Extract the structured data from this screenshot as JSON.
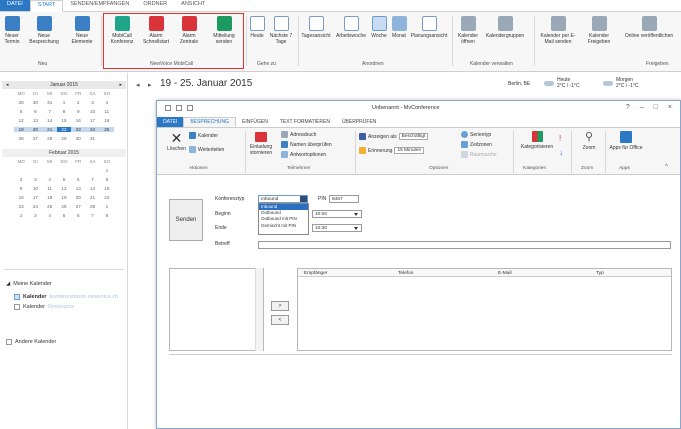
{
  "outlook": {
    "tabs": [
      {
        "label": "DATEI"
      },
      {
        "label": "START"
      },
      {
        "label": "SENDEN/EMPFANGEN"
      },
      {
        "label": "ORDNER"
      },
      {
        "label": "ANSICHT"
      }
    ],
    "ribbon": {
      "neu": {
        "items": [
          "Neuer Termin",
          "Neue Besprechung",
          "Neue Elemente"
        ],
        "label": "Neu"
      },
      "mobicall": {
        "items": [
          "MobiCall Konferenz",
          "Alarm Schnellstart",
          "Alarm Zentrale",
          "Mitteilung senden"
        ],
        "label": "NewVoice MobiCall"
      },
      "gehe_zu": {
        "items": [
          "Heute",
          "Nächste 7 Tage"
        ],
        "label": "Gehe zu"
      },
      "anordnen": {
        "items": [
          "Tagesansicht",
          "Arbeitswoche",
          "Woche",
          "Monat",
          "Planungsansicht"
        ],
        "label": "Anordnen"
      },
      "kalender_verwalten": {
        "items": [
          "Kalender öffnen",
          "Kalendergruppen"
        ],
        "label": "Kalender verwalten"
      },
      "freigeben": {
        "items": [
          "Kalender per E-Mail senden",
          "Kalender Freigeben",
          "Online veröffentlichen"
        ],
        "label": "Freigeben"
      }
    },
    "mini_calendars": [
      {
        "title": "Januar 2015",
        "dow": [
          "MO",
          "DI",
          "MI",
          "DO",
          "FR",
          "SA",
          "SO"
        ],
        "weeks": [
          [
            "29",
            "30",
            "31",
            "1",
            "2",
            "3",
            "4"
          ],
          [
            "5",
            "6",
            "7",
            "8",
            "9",
            "10",
            "11"
          ],
          [
            "12",
            "13",
            "14",
            "15",
            "16",
            "17",
            "18"
          ],
          [
            "19",
            "20",
            "21",
            "22",
            "23",
            "24",
            "25"
          ],
          [
            "26",
            "27",
            "28",
            "29",
            "30",
            "31",
            ""
          ]
        ]
      },
      {
        "title": "Februar 2015",
        "dow": [
          "MO",
          "DI",
          "MI",
          "DO",
          "FR",
          "SA",
          "SO"
        ],
        "weeks": [
          [
            "",
            "",
            "",
            "",
            "",
            "",
            "1"
          ],
          [
            "2",
            "3",
            "4",
            "5",
            "6",
            "7",
            "8"
          ],
          [
            "9",
            "10",
            "11",
            "12",
            "13",
            "14",
            "15"
          ],
          [
            "16",
            "17",
            "18",
            "19",
            "20",
            "21",
            "22"
          ],
          [
            "23",
            "24",
            "25",
            "26",
            "27",
            "28",
            "1"
          ],
          [
            "2",
            "3",
            "4",
            "5",
            "6",
            "7",
            "8"
          ]
        ]
      }
    ],
    "nav_tree": {
      "group": "Meine Kalender",
      "items": [
        {
          "label": "Kalender",
          "extra": "konferenzraum.newvoice.ch"
        },
        {
          "label": "Kalender",
          "extra": "Ressource"
        }
      ],
      "other": "Andere Kalender"
    },
    "calendar_header": {
      "range": "19 - 25. Januar 2015",
      "city": "Berlin, BE",
      "today_label": "Heute",
      "today_temp": "2°C / -1°C",
      "tomorrow_label": "Morgen",
      "tomorrow_temp": "2°C / -1°C"
    }
  },
  "meeting": {
    "title": "Unbenannt - MvConference",
    "tabs": [
      "DATEI",
      "BESPRECHUNG",
      "EINFÜGEN",
      "TEXT FORMATIEREN",
      "ÜBERPRÜFEN"
    ],
    "ribbon": {
      "aktionen": {
        "items": [
          "Löschen",
          "Kalender",
          "Weiterleiten"
        ],
        "label": "Aktionen"
      },
      "teilnehmer": {
        "items": [
          "Einladung stornieren",
          "Adressbuch",
          "Namen überprüfen",
          "Antwortoptionen"
        ],
        "label": "Teilnehmer"
      },
      "optionen": {
        "show_as_label": "Anzeigen als",
        "show_as_value": "Beschäftigt",
        "reminder_label": "Erinnerung",
        "reminder_value": "15 Minuten",
        "items": [
          "Serientyp",
          "Zeitzonen",
          "Raumsuche"
        ],
        "label": "Optionen"
      },
      "kategorien": {
        "items": [
          "Kategorisieren"
        ],
        "label": "Kategorien"
      },
      "zoom": {
        "items": [
          "Zoom"
        ],
        "label": "Zoom"
      },
      "apps": {
        "items": [
          "Apps für Office"
        ],
        "label": "Apps"
      }
    },
    "form": {
      "send_label": "Senden",
      "type_label": "Konferenztyp",
      "type_value": "Inbound",
      "type_options": [
        "Inbound",
        "Outbound",
        "Outbound mit PIN",
        "Gemischt mit PIN"
      ],
      "pin_label": "PIN",
      "pin_value": "8467",
      "begin_label": "Beginn",
      "begin_time": "10:00",
      "end_label": "Ende",
      "end_time": "10:30",
      "subject_label": "Betreff"
    },
    "participants": {
      "add_button": ">",
      "remove_button": "<",
      "columns": [
        "Empfänger",
        "Telefon",
        "E-Mail",
        "Typ"
      ]
    }
  }
}
